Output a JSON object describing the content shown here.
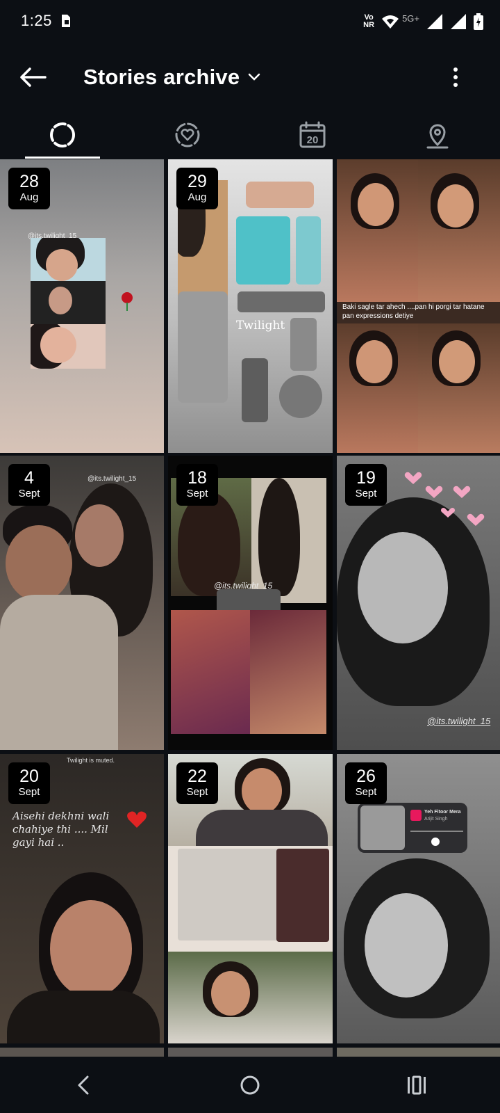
{
  "status_bar": {
    "time": "1:25",
    "volte_top": "Vo",
    "volte_bottom": "NR",
    "network": "5G+",
    "icons": [
      "sim-card-icon",
      "volte-icon",
      "wifi-icon",
      "signal-icon",
      "signal-icon",
      "battery-icon"
    ]
  },
  "header": {
    "title": "Stories archive",
    "back_icon": "arrow-left-icon",
    "dropdown_icon": "chevron-down-icon",
    "more_icon": "more-vertical-icon"
  },
  "tabs": [
    {
      "name": "stories",
      "icon": "story-ring-icon",
      "active": true
    },
    {
      "name": "highlights",
      "icon": "heart-ring-icon",
      "active": false
    },
    {
      "name": "calendar",
      "icon": "calendar-icon",
      "calendar_day": "20",
      "active": false
    },
    {
      "name": "map",
      "icon": "map-pin-icon",
      "active": false
    }
  ],
  "stories": [
    {
      "day": "28",
      "month": "Aug",
      "caption": "@its.twilight_15"
    },
    {
      "day": "29",
      "month": "Aug",
      "caption": "Twilight"
    },
    {
      "day": "",
      "month": "",
      "caption": "Baki sagle tar ahech ....pan hi porgi tar hatane pan expressions detiye"
    },
    {
      "day": "4",
      "month": "Sept",
      "caption": "@its.twilight_15"
    },
    {
      "day": "18",
      "month": "Sept",
      "caption": "@its.twilight_15"
    },
    {
      "day": "19",
      "month": "Sept",
      "caption": "@its.twilight_15"
    },
    {
      "day": "20",
      "month": "Sept",
      "caption": "Aisehi dekhni wali chahiye thi .... Mil gayi hai ..",
      "muted_text": "Twilight is muted."
    },
    {
      "day": "22",
      "month": "Sept",
      "caption": ""
    },
    {
      "day": "26",
      "month": "Sept",
      "caption": "",
      "music_title": "Yeh Fitoor Mera",
      "music_artist": "Arijit Singh"
    }
  ],
  "nav": {
    "back_icon": "nav-back-icon",
    "home_icon": "nav-home-icon",
    "recents_icon": "nav-recents-icon"
  }
}
